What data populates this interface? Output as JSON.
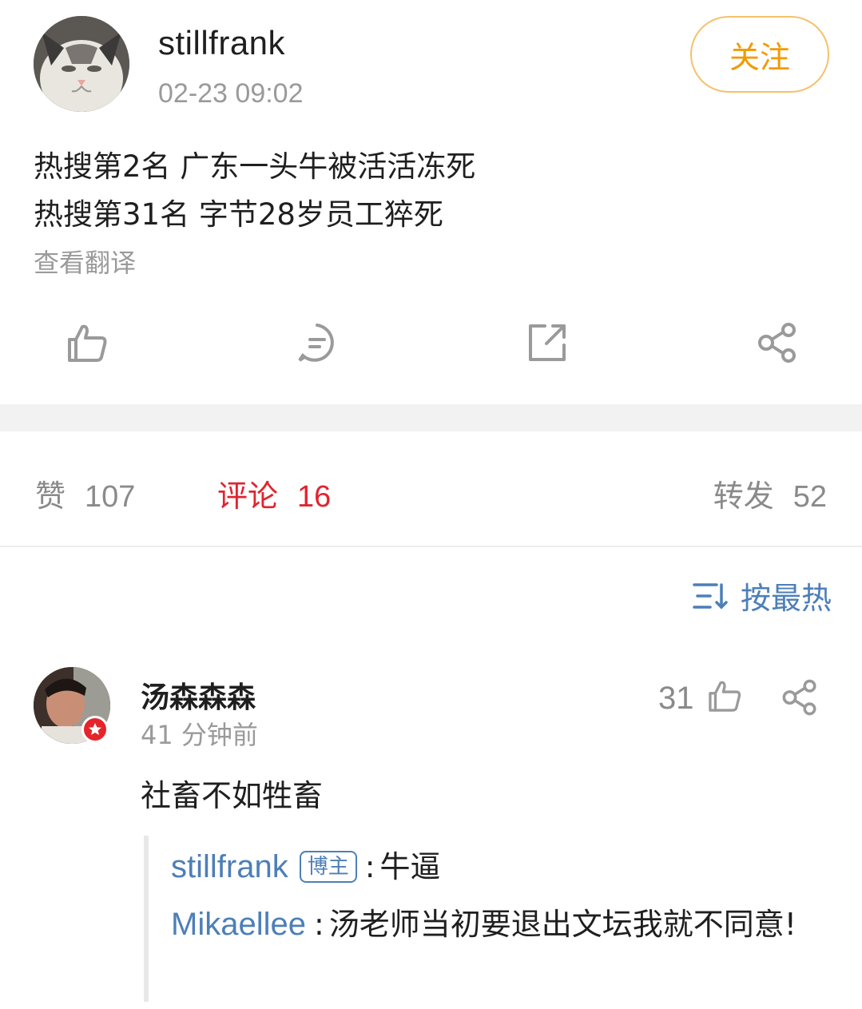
{
  "post": {
    "author": "stillfrank",
    "time": "02-23 09:02",
    "follow_label": "关注",
    "lines": [
      "热搜第2名 广东一头牛被活活冻死",
      "热搜第31名 字节28岁员工猝死"
    ],
    "translate_label": "查看翻译"
  },
  "actions": [
    {
      "icon": "thumbs-up-icon"
    },
    {
      "icon": "comment-icon"
    },
    {
      "icon": "repost-icon"
    },
    {
      "icon": "share-icon"
    }
  ],
  "counts": {
    "like_label": "赞",
    "like_count": "107",
    "comment_label": "评论",
    "comment_count": "16",
    "repost_label": "转发",
    "repost_count": "52"
  },
  "sort": {
    "label": "按最热",
    "icon": "sort-icon"
  },
  "comment": {
    "user": "汤森森森",
    "time": "41 分钟前",
    "like_count": "31",
    "text": "社畜不如牲畜",
    "replies": [
      {
        "user": "stillfrank",
        "tag": "博主",
        "text": "牛逼"
      },
      {
        "user": "Mikaellee",
        "text": "汤老师当初要退出文坛我就不同意!"
      }
    ]
  },
  "colors": {
    "accent_orange": "#f29a00",
    "link_blue": "#4d7fb8",
    "active_red": "#e0242f",
    "muted_gray": "#9a9a9a"
  }
}
